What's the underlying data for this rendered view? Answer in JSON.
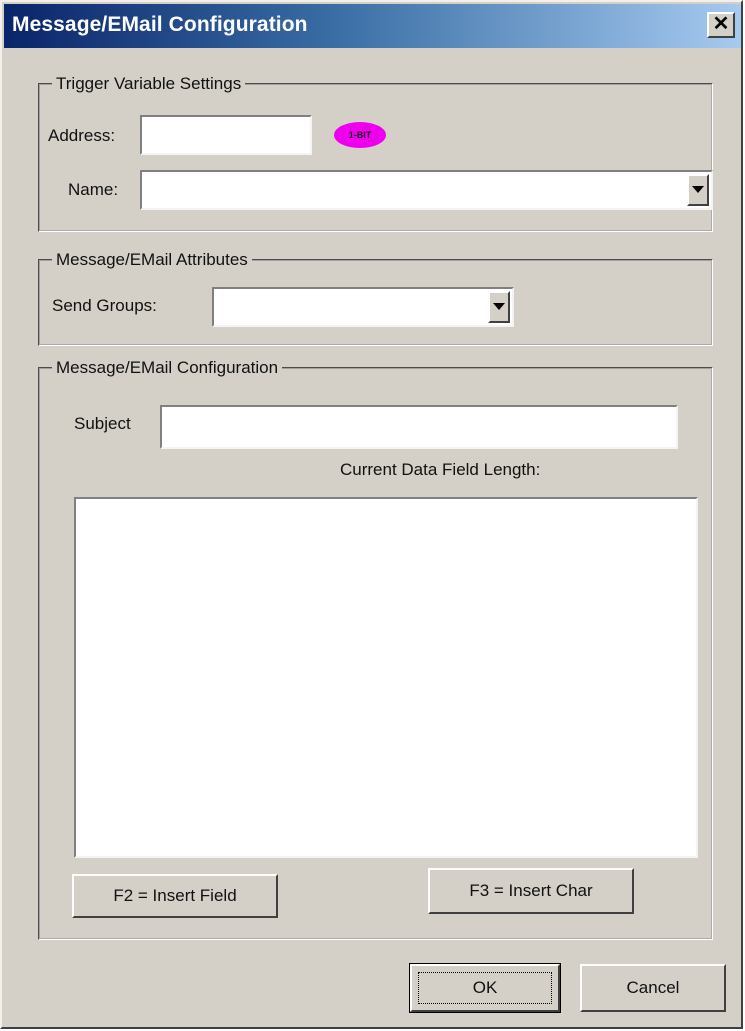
{
  "window": {
    "title": "Message/EMail Configuration",
    "close_glyph": "✕"
  },
  "trigger_group": {
    "legend": "Trigger Variable Settings",
    "address_label": "Address:",
    "address_value": "",
    "badge": "1-BIT",
    "badge_color": "#ee00ee",
    "name_label": "Name:",
    "name_value": ""
  },
  "attributes_group": {
    "legend": "Message/EMail Attributes",
    "send_groups_label": "Send Groups:",
    "send_groups_value": ""
  },
  "config_group": {
    "legend": "Message/EMail Configuration",
    "subject_label": "Subject",
    "subject_value": "",
    "data_length_label": "Current Data Field Length:",
    "body_value": "",
    "insert_field_button": "F2 = Insert Field",
    "insert_char_button": "F3 = Insert Char"
  },
  "footer": {
    "ok_button": "OK",
    "cancel_button": "Cancel"
  },
  "icons": {
    "close": "close-icon",
    "dropdown": "chevron-down-icon"
  }
}
